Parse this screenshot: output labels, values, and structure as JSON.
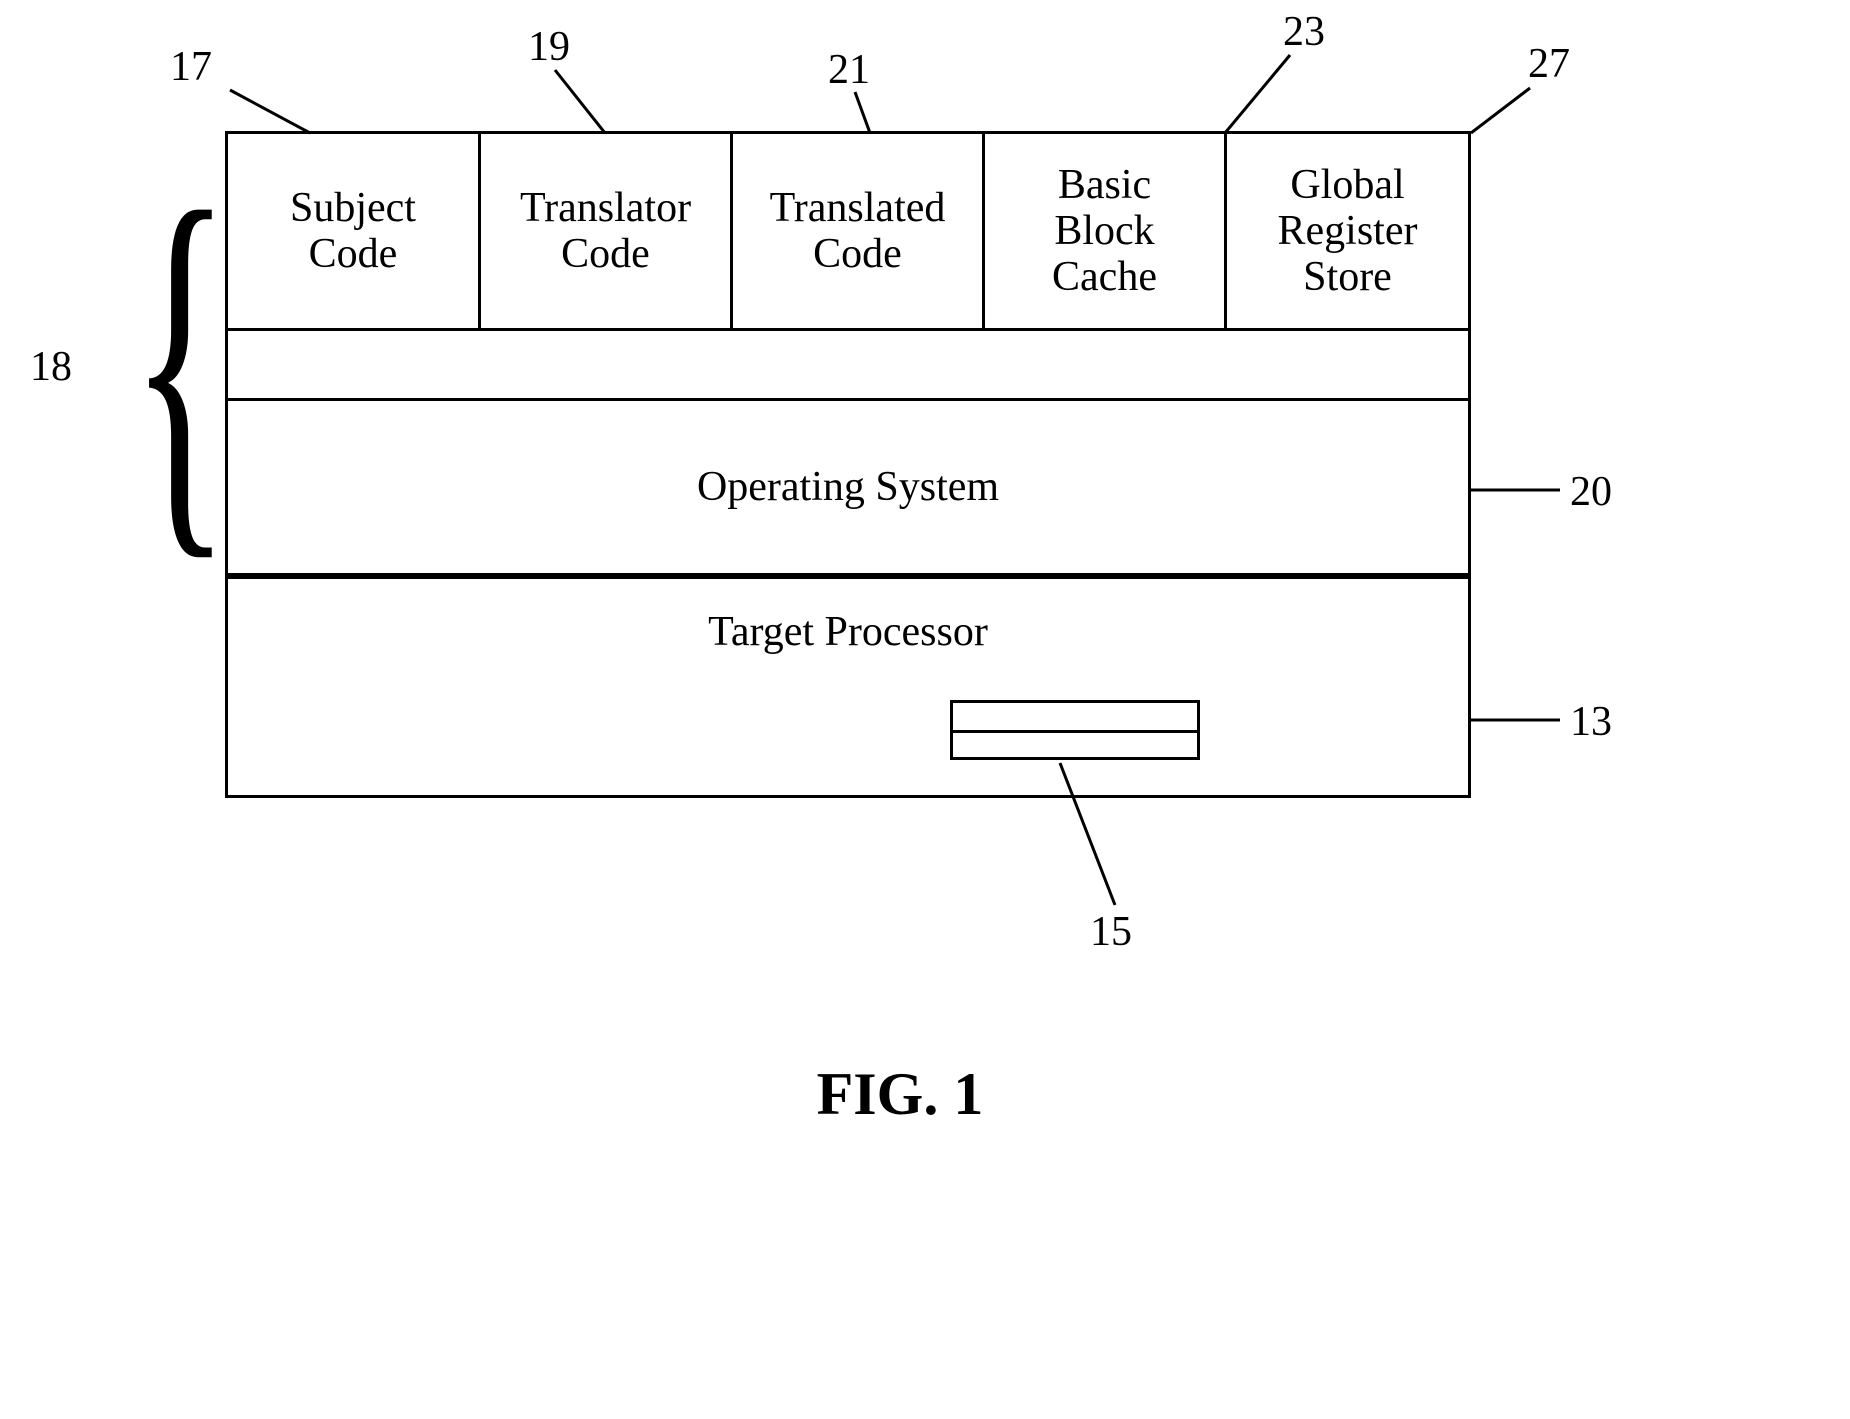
{
  "refs": {
    "r17": "17",
    "r19": "19",
    "r21": "21",
    "r23": "23",
    "r27": "27",
    "r18": "18",
    "r20": "20",
    "r13": "13",
    "r15": "15"
  },
  "blocks": {
    "subject_code": "Subject\nCode",
    "translator_code": "Translator\nCode",
    "translated_code": "Translated\nCode",
    "basic_block_cache": "Basic\nBlock\nCache",
    "global_register_store": "Global\nRegister\nStore",
    "operating_system": "Operating System",
    "target_processor": "Target Processor"
  },
  "figure_caption": "FIG. 1"
}
